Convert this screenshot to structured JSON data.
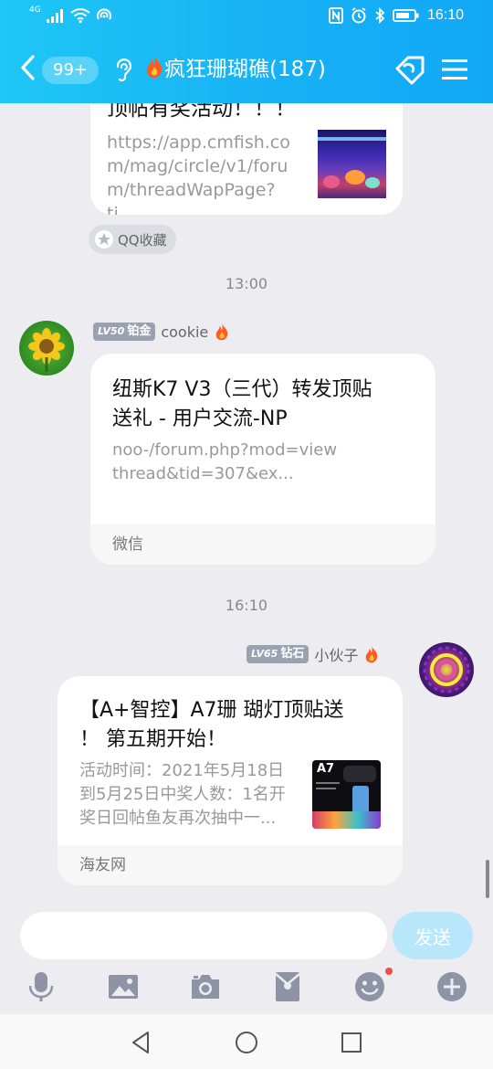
{
  "status_bar": {
    "network": "4G",
    "time": "16:10"
  },
  "titlebar": {
    "unread_badge": "99+",
    "group_name": "疯狂珊瑚礁(187)"
  },
  "messages": {
    "msg1": {
      "title_partial": "顶帖有奖活动！！！",
      "url": "https://app.cmfish.com/mag/circle/v1/forum/threadWapPage?ti...",
      "url_lines": [
        "https://app.cmfish.co",
        "m/mag/circle/v1/foru",
        "m/threadWapPage?ti..."
      ],
      "fav_label": "QQ收藏"
    },
    "time1": "13:00",
    "msg2": {
      "level": "LV50",
      "rank": "铂金",
      "sender": "cookie",
      "title_lines": [
        "纽斯K7 V3（三代）转发顶贴",
        "送礼 - 用户交流-NP"
      ],
      "desc_lines": [
        "noo-/forum.php?mod=view",
        "thread&tid=307&ex..."
      ],
      "source": "微信"
    },
    "time2": "16:10",
    "msg3": {
      "level": "LV65",
      "rank": "钻石",
      "sender": "小伙子",
      "title_lines": [
        "【A+智控】A7珊 瑚灯顶贴送",
        "！ 第五期开始！"
      ],
      "desc_lines": [
        "活动时间：2021年5月18日",
        "到5月25日中奖人数：1名开",
        "奖日回帖鱼友再次抽中一..."
      ],
      "thumb_label": "A7",
      "source": "海友网"
    }
  },
  "input": {
    "placeholder": "",
    "send_label": "发送"
  },
  "colors": {
    "header_start": "#1ec7f5",
    "header_end": "#12a8f6",
    "send_disabled": "#b8e7fb",
    "badge_level": "#9aa2b1",
    "notification_dot": "#f24d4d"
  }
}
